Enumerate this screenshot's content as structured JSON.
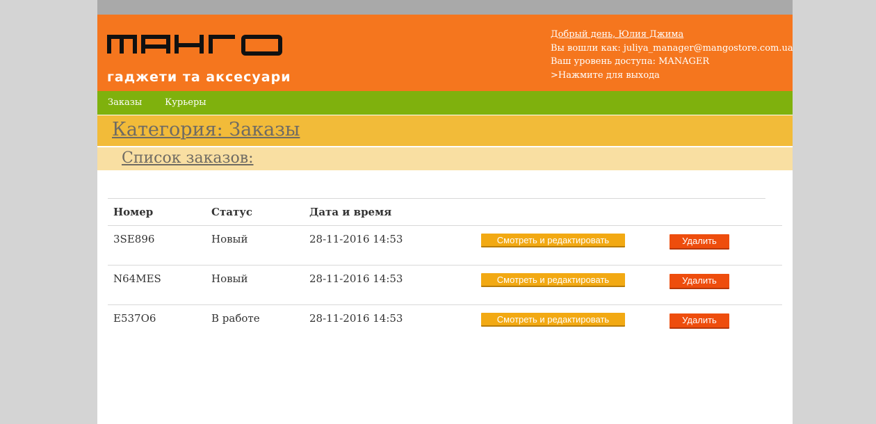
{
  "brand": {
    "logo_text": "МАНГО",
    "tagline": "гаджети та аксесуари"
  },
  "user": {
    "greeting": "Добрый день, Юлия Джима",
    "logged_in_as": "Вы вошли как: juliya_manager@mangostore.com.ua",
    "access_level": "Ваш уровень доступа: MANAGER",
    "logout": ">Нажмите для выхода"
  },
  "nav": {
    "items": [
      {
        "label": "Заказы"
      },
      {
        "label": "Курьеры"
      }
    ]
  },
  "category": {
    "title": "Категория: Заказы",
    "subtitle": "Список заказов:"
  },
  "table": {
    "headers": [
      "Номер",
      "Статус",
      "Дата и время"
    ],
    "rows": [
      {
        "number": "3SE896",
        "status": "Новый",
        "datetime": "28-11-2016 14:53"
      },
      {
        "number": "N64MES",
        "status": "Новый",
        "datetime": "28-11-2016 14:53"
      },
      {
        "number": "E537O6",
        "status": "В работе",
        "datetime": "28-11-2016 14:53"
      }
    ],
    "edit_label": "Смотреть и редактировать",
    "delete_label": "Удалить"
  },
  "colors": {
    "header": "#f5761e",
    "nav": "#7fb10d",
    "category": "#f2bb39",
    "sublist": "#f9dfa2",
    "edit_button": "#f2a913",
    "delete_button": "#ee4d0d"
  }
}
